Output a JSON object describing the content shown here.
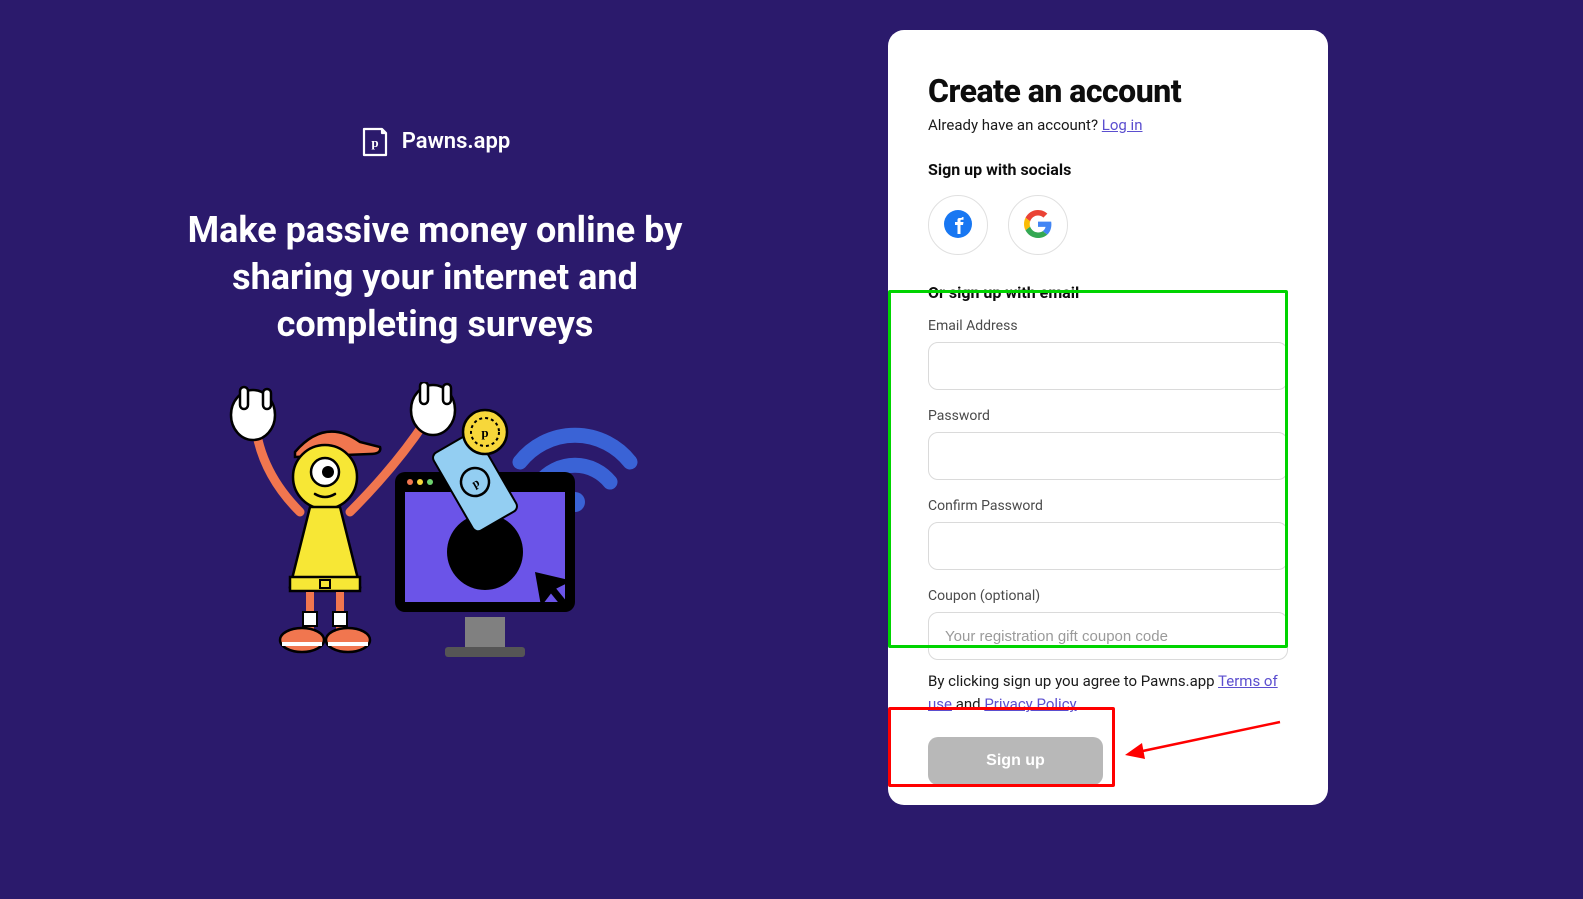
{
  "brand": {
    "logo_text": "Pawns.app"
  },
  "hero": {
    "headline": "Make passive money online by sharing your internet and completing surveys"
  },
  "card": {
    "title": "Create an account",
    "already_text": "Already have an account? ",
    "login_link": "Log in",
    "socials_label": "Sign up with socials",
    "email_label": "Or sign up with email",
    "fields": {
      "email": {
        "label": "Email Address",
        "value": ""
      },
      "password": {
        "label": "Password",
        "value": ""
      },
      "confirm": {
        "label": "Confirm Password",
        "value": ""
      },
      "coupon": {
        "label": "Coupon (optional)",
        "placeholder": "Your registration gift coupon code",
        "value": ""
      }
    },
    "terms_prefix": "By clicking sign up you agree to Pawns.app ",
    "terms_link": "Terms of use",
    "terms_and": " and ",
    "privacy_link": "Privacy Policy",
    "signup_button": "Sign up"
  }
}
